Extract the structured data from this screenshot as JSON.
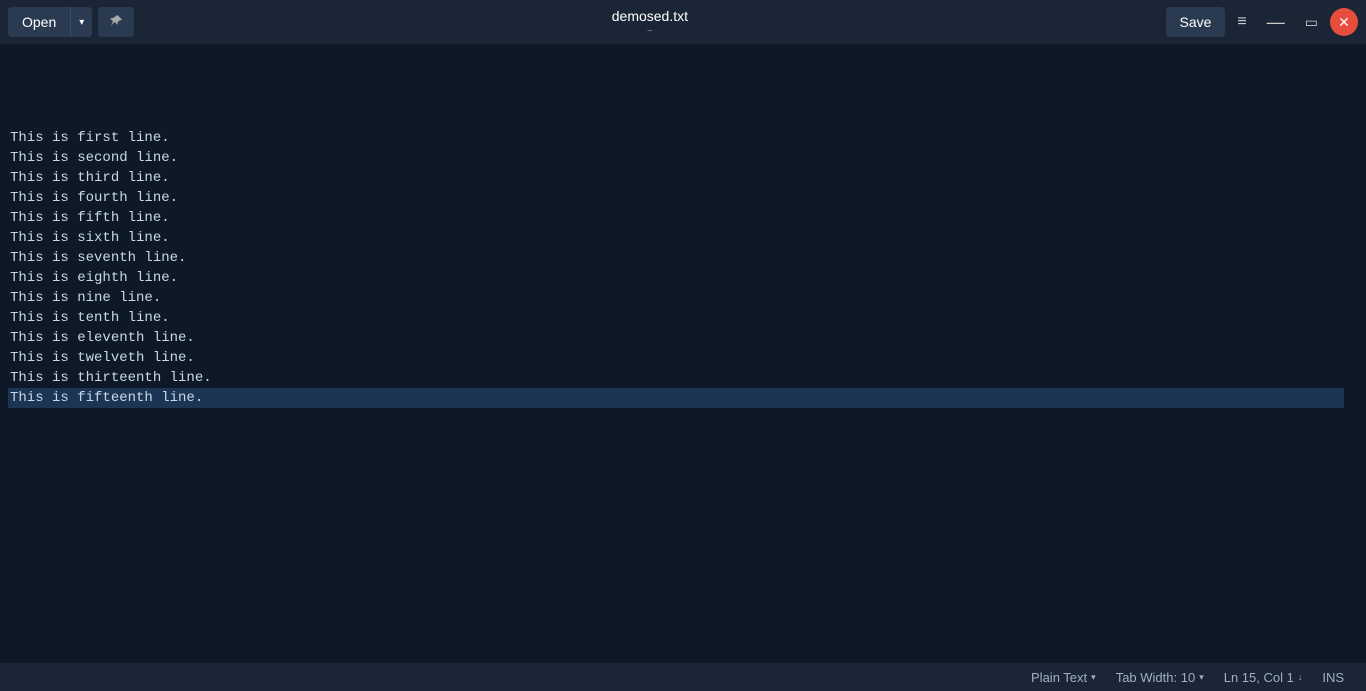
{
  "titlebar": {
    "open_label": "Open",
    "dropdown_arrow": "▾",
    "pin_icon": "📌",
    "title": "demosed.txt",
    "subtitle": "~",
    "save_label": "Save",
    "menu_icon": "≡",
    "minimize_icon": "—",
    "maximize_icon": "▭",
    "close_icon": "✕"
  },
  "editor": {
    "lines": [
      "This is first line.",
      "This is second line.",
      "This is third line.",
      "This is fourth line.",
      "This is fifth line.",
      "This is sixth line.",
      "This is seventh line.",
      "This is eighth line.",
      "This is nine line.",
      "This is tenth line.",
      "This is eleventh line.",
      "This is twelveth line.",
      "This is thirteenth line.",
      "This is fifteenth line.",
      ""
    ],
    "active_line": 14
  },
  "statusbar": {
    "plain_text_label": "Plain Text",
    "tab_width_label": "Tab Width: 10",
    "cursor_position": "Ln 15, Col 1",
    "ins_label": "INS",
    "chevron_down": "▾",
    "down_arrow": "↓"
  }
}
